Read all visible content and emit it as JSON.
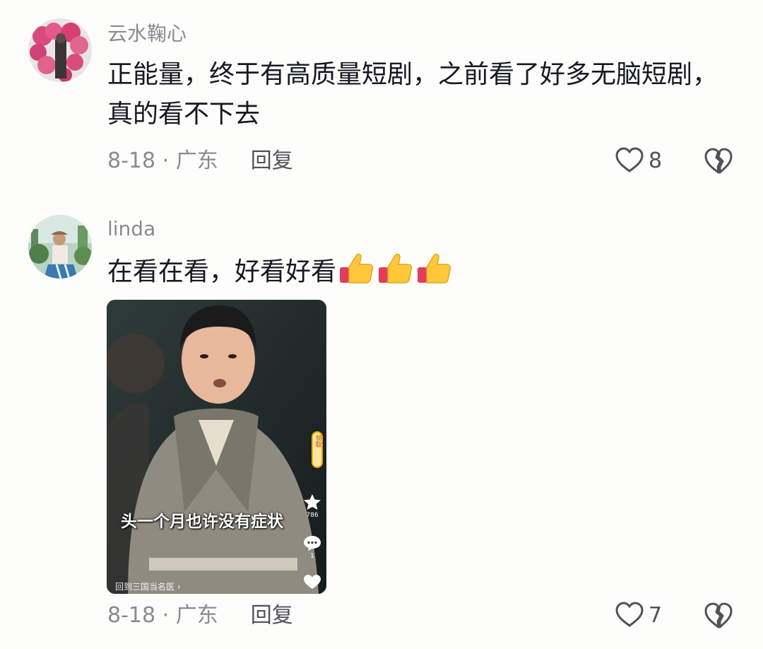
{
  "comments": [
    {
      "username": "云水鞠心",
      "text": "正能量，终于有高质量短剧，之前看了好多无脑短剧，真的看不下去",
      "date_location": "8-18 · 广东",
      "reply_label": "回复",
      "likes": "8"
    },
    {
      "username": "linda",
      "text": "在看在看，好看好看",
      "emoji": [
        "thumbs-up",
        "thumbs-up",
        "thumbs-up"
      ],
      "date_location": "8-18 · 广东",
      "reply_label": "回复",
      "likes": "7",
      "video": {
        "subtitle": "头一个月也许没有症状",
        "reward_label": "领取",
        "star_count": "786",
        "comment_count": "1",
        "bottom_text": "回到三国当名医 ›"
      }
    }
  ],
  "colors": {
    "background": "#fdfdfb",
    "text": "#161823",
    "secondary": "#8a8b91"
  }
}
